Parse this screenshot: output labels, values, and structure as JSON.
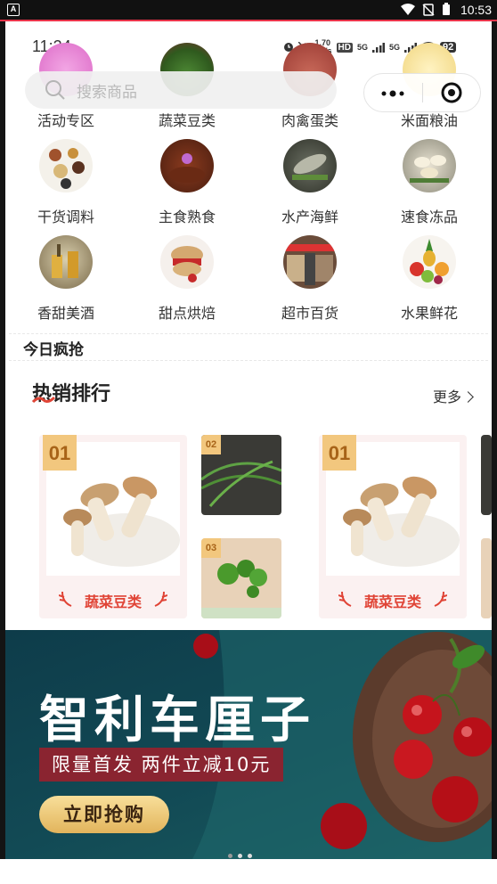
{
  "system_bar": {
    "time": "10:53",
    "app_badge": "A"
  },
  "inner_status": {
    "time": "11:24",
    "net1": "1.70",
    "net2": "KB/s",
    "hd": "HD",
    "sig1": "5G",
    "sig2": "5G",
    "battery": "92"
  },
  "search": {
    "placeholder": "搜索商品"
  },
  "capsule": {
    "more_icon": "more-dots-icon",
    "close_icon": "target-close-icon"
  },
  "categories": [
    {
      "label": "活动专区",
      "icon": "activity-icon"
    },
    {
      "label": "蔬菜豆类",
      "icon": "vegetable-icon"
    },
    {
      "label": "肉禽蛋类",
      "icon": "meat-icon"
    },
    {
      "label": "米面粮油",
      "icon": "grain-icon"
    },
    {
      "label": "干货调料",
      "icon": "dried-goods-icon"
    },
    {
      "label": "主食熟食",
      "icon": "cooked-food-icon"
    },
    {
      "label": "水产海鲜",
      "icon": "seafood-icon"
    },
    {
      "label": "速食冻品",
      "icon": "frozen-food-icon"
    },
    {
      "label": "香甜美酒",
      "icon": "wine-icon"
    },
    {
      "label": "甜点烘焙",
      "icon": "dessert-icon"
    },
    {
      "label": "超市百货",
      "icon": "supermarket-icon"
    },
    {
      "label": "水果鲜花",
      "icon": "fruit-icon"
    }
  ],
  "today": {
    "title": "今日疯抢"
  },
  "hot": {
    "title": "热销排行",
    "more": "更多"
  },
  "ranking": [
    {
      "rank": "01",
      "label": "蔬菜豆类",
      "sub": [
        {
          "rank": "02"
        },
        {
          "rank": "03"
        }
      ]
    },
    {
      "rank": "01",
      "label": "蔬菜豆类"
    }
  ],
  "banner": {
    "title": "智利车厘子",
    "subtitle": "限量首发 两件立减10元",
    "button": "立即抢购"
  },
  "colors": {
    "accent": "#e04436",
    "badge": "#f2c77e",
    "banner_bg": "#124a55",
    "status_red": "#e8344a"
  }
}
